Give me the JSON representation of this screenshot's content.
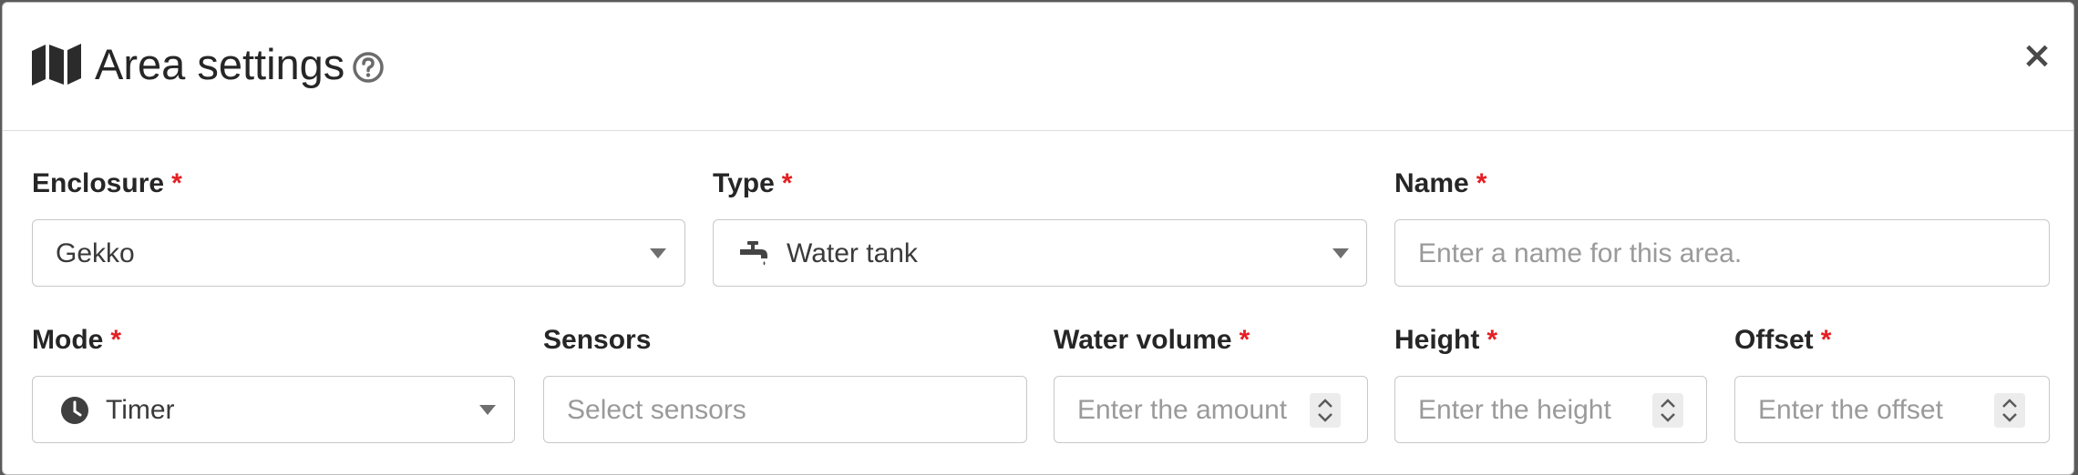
{
  "dialog": {
    "title": "Area settings",
    "header_icon": "map-icon",
    "help_icon": "question-circle-icon",
    "close_label": "×"
  },
  "fields": {
    "required_mark": "*",
    "enclosure": {
      "label": "Enclosure",
      "value": "Gekko"
    },
    "type": {
      "label": "Type",
      "value": "Water tank",
      "icon": "faucet-icon"
    },
    "name": {
      "label": "Name",
      "placeholder": "Enter a name for this area."
    },
    "mode": {
      "label": "Mode",
      "value": "Timer",
      "icon": "clock-icon"
    },
    "sensors": {
      "label": "Sensors",
      "placeholder": "Select sensors"
    },
    "water_volume": {
      "label": "Water volume",
      "placeholder": "Enter the amount"
    },
    "height": {
      "label": "Height",
      "placeholder": "Enter the height"
    },
    "offset": {
      "label": "Offset",
      "placeholder": "Enter the offset"
    }
  },
  "colors": {
    "required": "#e51e23",
    "text": "#262626",
    "placeholder": "#9a9a9a",
    "border": "#c8c8c8"
  }
}
